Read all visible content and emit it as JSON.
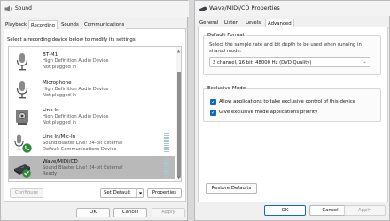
{
  "sound": {
    "title": "Sound",
    "tabs": [
      "Playback",
      "Recording",
      "Sounds",
      "Communications"
    ],
    "active_tab": "Recording",
    "instructions": "Select a recording device below to modify its settings:",
    "devices": [
      {
        "name": "BT-M1",
        "desc": "High Definition Audio Device",
        "status": "Not plugged in",
        "icon": "microphone-icon"
      },
      {
        "name": "Microphone",
        "desc": "High Definition Audio Device",
        "status": "Not plugged in",
        "icon": "microphone-icon"
      },
      {
        "name": "Line In",
        "desc": "High Definition Audio Device",
        "status": "Not plugged in",
        "icon": "line-in-jack-icon"
      },
      {
        "name": "Line In/Mic-In",
        "desc": "Sound Blaster Live! 24-bit External",
        "status": "Default Communications Device",
        "icon": "microphone-icon",
        "badge": "phone-icon"
      },
      {
        "name": "Wave/MIDI/CD",
        "desc": "Sound Blaster Live! 24-bit External",
        "status": "Ready",
        "icon": "sound-card-icon",
        "badge": "checkmark-icon",
        "selected": true
      }
    ],
    "buttons": {
      "configure": "Configure",
      "set_default": "Set Default",
      "properties": "Properties",
      "ok": "OK",
      "cancel": "Cancel",
      "apply": "Apply"
    }
  },
  "props": {
    "title": "Wave/MIDI/CD Properties",
    "tabs": [
      "General",
      "Listen",
      "Levels",
      "Advanced"
    ],
    "active_tab": "Advanced",
    "default_format": {
      "heading": "Default Format",
      "description": "Select the sample rate and bit depth to be used when running in shared mode.",
      "selected": "2 channel, 16 bit, 48000 Hz (DVD Quality)"
    },
    "exclusive_mode": {
      "heading": "Exclusive Mode",
      "options": [
        {
          "label": "Allow applications to take exclusive control of this device",
          "checked": true
        },
        {
          "label": "Give exclusive mode applications priority",
          "checked": true
        }
      ]
    },
    "buttons": {
      "restore": "Restore Defaults",
      "ok": "OK",
      "cancel": "Cancel",
      "apply": "Apply"
    }
  },
  "colors": {
    "accent": "#0f6cbd",
    "selected_row": "#b9b9b9",
    "level_meter": "#aac6cc",
    "badge_green": "#2e8b3a"
  }
}
